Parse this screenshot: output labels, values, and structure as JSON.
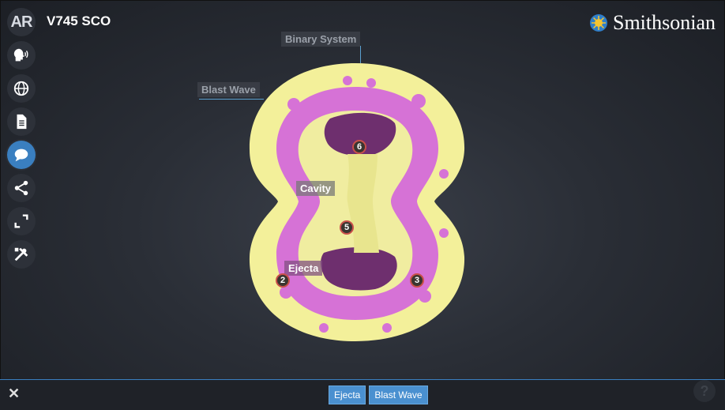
{
  "app": {
    "ar_label": "AR",
    "title": "V745 SCO",
    "brand": "Smithsonian"
  },
  "toolbar": {
    "items": [
      {
        "icon": "audio-narration-icon"
      },
      {
        "icon": "globe-icon"
      },
      {
        "icon": "document-icon"
      },
      {
        "icon": "annotations-icon",
        "active": true
      },
      {
        "icon": "share-icon"
      },
      {
        "icon": "fullscreen-icon"
      },
      {
        "icon": "tools-icon"
      }
    ]
  },
  "annotations": {
    "binary_system": "Binary System",
    "blast_wave": "Blast Wave",
    "cavity": "Cavity",
    "ejecta": "Ejecta"
  },
  "markers": {
    "m6": "6",
    "m5": "5",
    "m2": "2",
    "m3": "3"
  },
  "bottom": {
    "close": "✕",
    "tags": [
      "Ejecta",
      "Blast Wave"
    ],
    "help": "?"
  },
  "colors": {
    "accent": "#3a7fc0",
    "shell": "#f3f09a",
    "ejecta": "#d672d6",
    "cavity": "#6e2f6e"
  }
}
